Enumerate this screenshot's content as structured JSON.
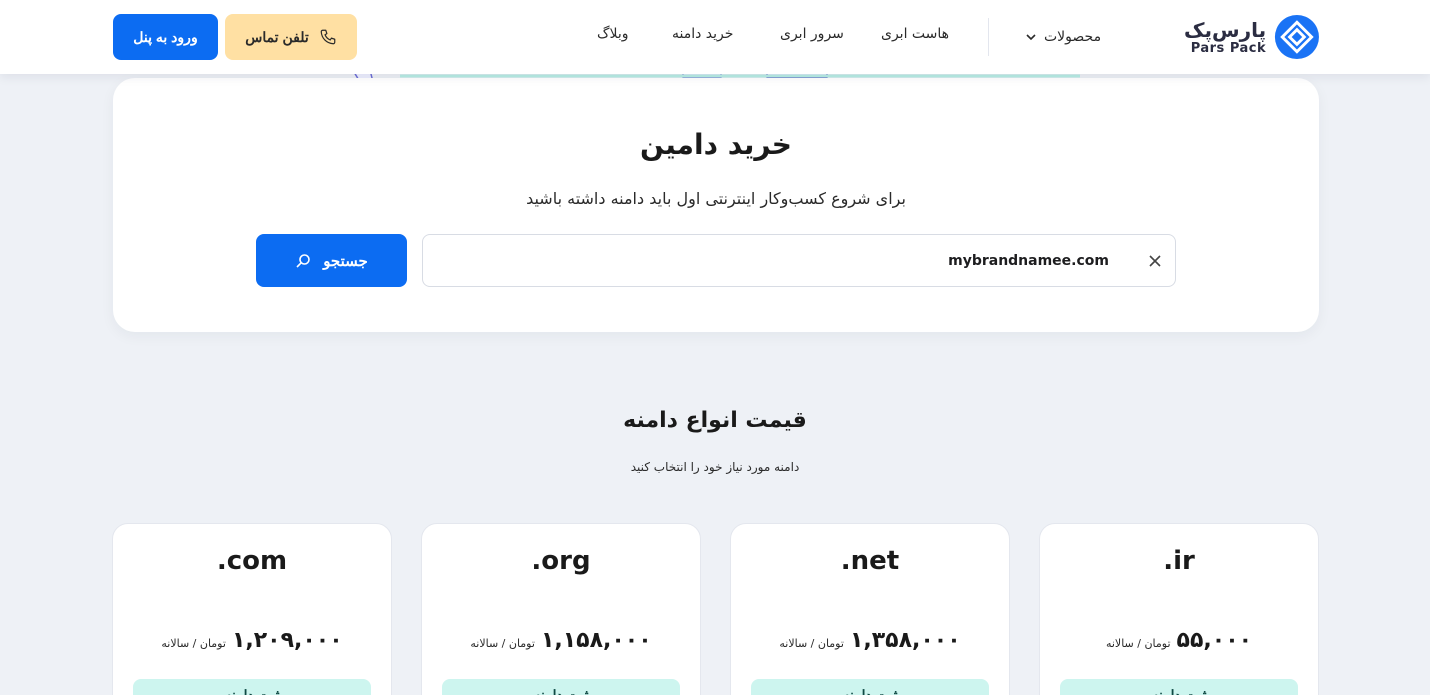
{
  "header": {
    "logo_fa": "پارس‌پک",
    "logo_en": "Pars Pack",
    "nav": {
      "products": "محصولات",
      "cloud_host": "هاست ابری",
      "cloud_server": "سرور ابری",
      "buy_domain": "خرید دامنه",
      "blog": "وبلاگ"
    },
    "phone_label": "تلفن تماس",
    "login_label": "ورود به پنل"
  },
  "hero": {
    "title": "خرید دامین",
    "subtitle": "برای شروع کسب‌وکار اینترنتی اول باید دامنه داشته باشید",
    "search_value": "mybrandnamee.com",
    "search_button": "جستجو"
  },
  "prices_section": {
    "title": "قیمت انواع دامنه",
    "subtitle": "دامنه مورد نیاز خود را انتخاب کنید"
  },
  "domain_cards": [
    {
      "tld": ".ir",
      "price": "۵۵,۰۰۰",
      "unit": "تومان / سالانه",
      "button": "ثبت دامنه"
    },
    {
      "tld": ".net",
      "price": "۱,۳۵۸,۰۰۰",
      "unit": "تومان / سالانه",
      "button": "ثبت دامنه"
    },
    {
      "tld": ".org",
      "price": "۱,۱۵۸,۰۰۰",
      "unit": "تومان / سالانه",
      "button": "ثبت دامنه"
    },
    {
      "tld": ".com",
      "price": "۱,۲۰۹,۰۰۰",
      "unit": "تومان / سالانه",
      "button": "ثبت دامنه"
    }
  ],
  "colors": {
    "primary_blue": "#0c6cf2",
    "phone_button_bg": "#ffe0a3",
    "card_button_bg": "#cdf5ef",
    "page_bg": "#eef1f6"
  }
}
